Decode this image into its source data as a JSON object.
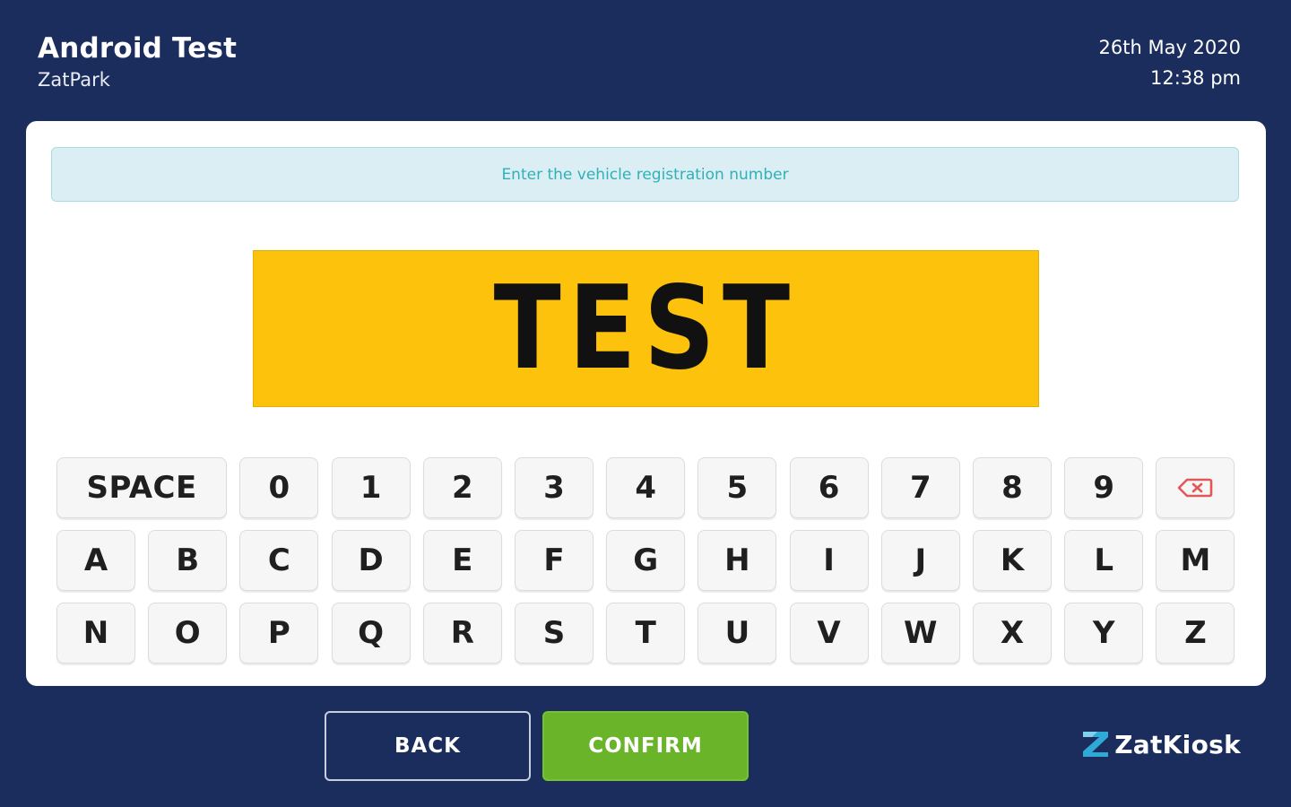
{
  "header": {
    "site_name": "Android Test",
    "operator": "ZatPark",
    "date": "26th May 2020",
    "time": "12:38 pm"
  },
  "instruction": "Enter the vehicle registration number",
  "plate": {
    "value": "TEST",
    "color": "#fdc20c"
  },
  "keyboard": {
    "row1": [
      "SPACE",
      "0",
      "1",
      "2",
      "3",
      "4",
      "5",
      "6",
      "7",
      "8",
      "9"
    ],
    "backspace_icon": "backspace-icon",
    "row2": [
      "A",
      "B",
      "C",
      "D",
      "E",
      "F",
      "G",
      "H",
      "I",
      "J",
      "K",
      "L",
      "M"
    ],
    "row3": [
      "N",
      "O",
      "P",
      "Q",
      "R",
      "S",
      "T",
      "U",
      "V",
      "W",
      "X",
      "Y",
      "Z"
    ]
  },
  "footer": {
    "back_label": "BACK",
    "confirm_label": "CONFIRM",
    "brand": "ZatKiosk",
    "brand_icon": "zatkiosk-logo-icon"
  },
  "colors": {
    "background": "#1b2d5c",
    "confirm": "#6ab42a",
    "instruction_text": "#2fb1b7",
    "backspace": "#e05858"
  }
}
